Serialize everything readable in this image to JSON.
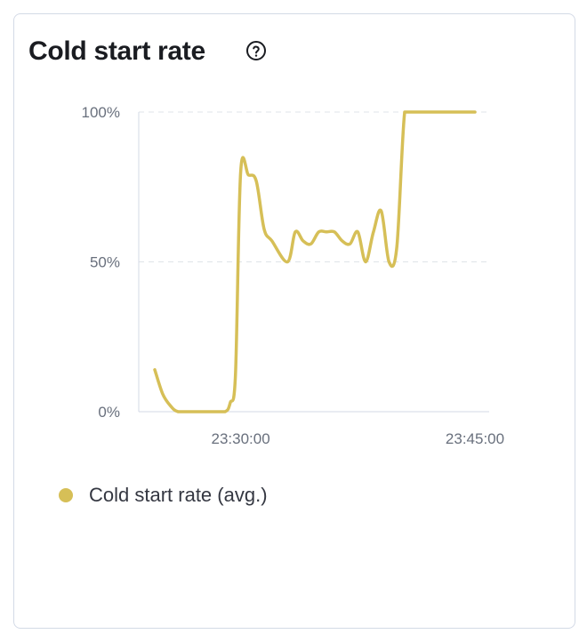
{
  "card": {
    "title": "Cold start rate",
    "help_icon": "question-circle-icon"
  },
  "colors": {
    "series": "#d6bf57",
    "grid": "#dfe3e8",
    "axis": "#d3dae6",
    "tick_text": "#69707d"
  },
  "chart_data": {
    "type": "line",
    "title": "Cold start rate",
    "xlabel": "",
    "ylabel": "",
    "y_ticks": [
      "0%",
      "50%",
      "100%"
    ],
    "x_ticks": [
      "23:30:00",
      "23:45:00"
    ],
    "ylim": [
      0,
      100
    ],
    "grid": true,
    "legend_placement": "bottom-left",
    "series": [
      {
        "name": "Cold start rate (avg.)",
        "x": [
          "23:24:30",
          "23:25:00",
          "23:25:30",
          "23:26:00",
          "23:27:00",
          "23:28:00",
          "23:29:00",
          "23:29:20",
          "23:29:40",
          "23:30:00",
          "23:30:30",
          "23:31:00",
          "23:31:30",
          "23:32:00",
          "23:33:00",
          "23:33:30",
          "23:34:00",
          "23:34:30",
          "23:35:00",
          "23:35:30",
          "23:36:00",
          "23:36:30",
          "23:37:00",
          "23:37:30",
          "23:38:00",
          "23:38:30",
          "23:39:00",
          "23:39:30",
          "23:40:00",
          "23:40:30",
          "23:41:00",
          "23:41:30",
          "23:42:00",
          "23:42:30",
          "23:43:00",
          "23:43:30",
          "23:44:00",
          "23:44:30",
          "23:45:00"
        ],
        "y": [
          14,
          6,
          2,
          0,
          0,
          0,
          0,
          3,
          12,
          80,
          79,
          77,
          61,
          57,
          50,
          60,
          57,
          56,
          60,
          60,
          60,
          57,
          56,
          60,
          50,
          60,
          67,
          50,
          55,
          100,
          100,
          100,
          100,
          100,
          100,
          100,
          100,
          100,
          100
        ]
      }
    ]
  },
  "legend": {
    "items": [
      {
        "label": "Cold start rate (avg.)",
        "color": "#d6bf57"
      }
    ]
  }
}
